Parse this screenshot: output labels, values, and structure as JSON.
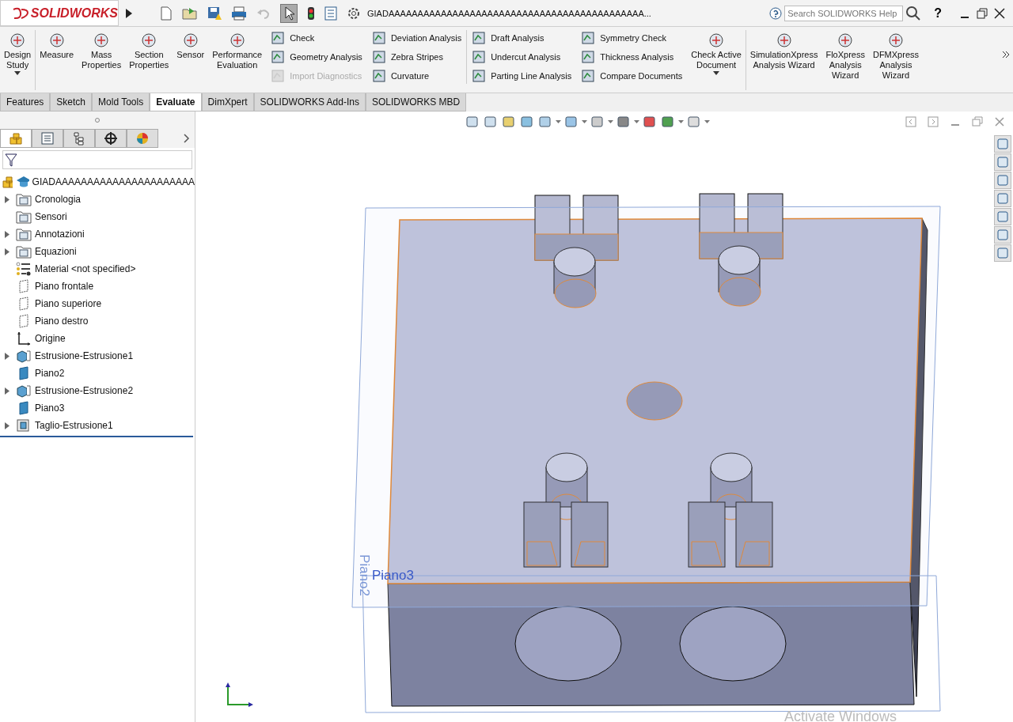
{
  "app": {
    "logo": "SOLIDWORKS",
    "document_title": "GIADAAAAAAAAAAAAAAAAAAAAAAAAAAAAAAAAAAAAAAAAAAAA...",
    "search": {
      "placeholder": "Search SOLIDWORKS Help"
    },
    "help": "?"
  },
  "ribbon": {
    "groups": [
      {
        "kind": "big",
        "items": [
          {
            "label": "Design\nStudy",
            "caret": true,
            "disabled": false
          }
        ]
      },
      {
        "kind": "big",
        "items": [
          {
            "label": "Measure",
            "caret": false,
            "disabled": false
          },
          {
            "label": "Mass\nProperties",
            "caret": false,
            "disabled": false
          },
          {
            "label": "Section\nProperties",
            "caret": false,
            "disabled": false
          },
          {
            "label": "Sensor",
            "caret": false,
            "disabled": false
          },
          {
            "label": "Performance\nEvaluation",
            "caret": false,
            "disabled": false
          }
        ]
      },
      {
        "kind": "small",
        "items": [
          {
            "label": "Check",
            "disabled": false
          },
          {
            "label": "Geometry Analysis",
            "disabled": false
          },
          {
            "label": "Import Diagnostics",
            "disabled": true
          }
        ]
      },
      {
        "kind": "small",
        "items": [
          {
            "label": "Deviation Analysis",
            "disabled": false
          },
          {
            "label": "Zebra Stripes",
            "disabled": false
          },
          {
            "label": "Curvature",
            "disabled": false
          }
        ]
      },
      {
        "kind": "small",
        "items": [
          {
            "label": "Draft Analysis",
            "disabled": false
          },
          {
            "label": "Undercut Analysis",
            "disabled": false
          },
          {
            "label": "Parting Line Analysis",
            "disabled": false
          }
        ]
      },
      {
        "kind": "small",
        "items": [
          {
            "label": "Symmetry Check",
            "disabled": false
          },
          {
            "label": "Thickness Analysis",
            "disabled": false
          },
          {
            "label": "Compare Documents",
            "disabled": false
          }
        ]
      },
      {
        "kind": "big",
        "items": [
          {
            "label": "Check Active\nDocument",
            "caret": true,
            "disabled": false
          }
        ]
      },
      {
        "kind": "big",
        "items": [
          {
            "label": "SimulationXpress\nAnalysis Wizard",
            "caret": false,
            "disabled": false
          },
          {
            "label": "FloXpress\nAnalysis\nWizard",
            "caret": false,
            "disabled": false
          },
          {
            "label": "DFMXpress\nAnalysis\nWizard",
            "caret": false,
            "disabled": false
          }
        ]
      }
    ]
  },
  "tabs": [
    {
      "label": "Features",
      "selected": false
    },
    {
      "label": "Sketch",
      "selected": false
    },
    {
      "label": "Mold Tools",
      "selected": false
    },
    {
      "label": "Evaluate",
      "selected": true
    },
    {
      "label": "DimXpert",
      "selected": false
    },
    {
      "label": "SOLIDWORKS Add-Ins",
      "selected": false
    },
    {
      "label": "SOLIDWORKS MBD",
      "selected": false
    }
  ],
  "panel_tabs": [
    {
      "selected": true
    },
    {
      "selected": false
    },
    {
      "selected": false
    },
    {
      "selected": false
    },
    {
      "selected": false
    }
  ],
  "tree": {
    "root": "GIADAAAAAAAAAAAAAAAAAAAAAA",
    "items": [
      {
        "label": "Cronologia",
        "kind": "history-folder",
        "expandable": true
      },
      {
        "label": "Sensori",
        "kind": "sensor-folder",
        "expandable": false
      },
      {
        "label": "Annotazioni",
        "kind": "annotation-folder",
        "expandable": true
      },
      {
        "label": "Equazioni",
        "kind": "equation-folder",
        "expandable": true
      },
      {
        "label": "Material <not specified>",
        "kind": "material",
        "expandable": false
      },
      {
        "label": "Piano frontale",
        "kind": "plane",
        "expandable": false
      },
      {
        "label": "Piano superiore",
        "kind": "plane",
        "expandable": false
      },
      {
        "label": "Piano destro",
        "kind": "plane",
        "expandable": false
      },
      {
        "label": "Origine",
        "kind": "origin",
        "expandable": false
      },
      {
        "label": "Estrusione-Estrusione1",
        "kind": "extrude",
        "expandable": true
      },
      {
        "label": "Piano2",
        "kind": "solid-plane",
        "expandable": false
      },
      {
        "label": "Estrusione-Estrusione2",
        "kind": "extrude",
        "expandable": true
      },
      {
        "label": "Piano3",
        "kind": "solid-plane",
        "expandable": false
      },
      {
        "label": "Taglio-Estrusione1",
        "kind": "cut",
        "expandable": true
      }
    ]
  },
  "viewport": {
    "plane_labels": [
      "Piano2",
      "Piano3"
    ],
    "watermark_text": "Activate Windows"
  }
}
